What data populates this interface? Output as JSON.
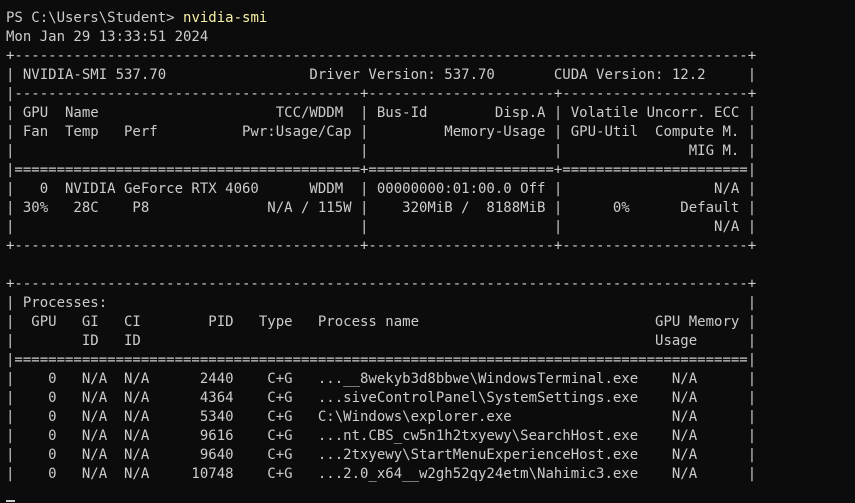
{
  "prompt": {
    "text": "PS C:\\Users\\Student> ",
    "command": "nvidia-smi"
  },
  "timestamp": "Mon Jan 29 13:33:51 2024",
  "output_lines": [
    "+---------------------------------------------------------------------------------------+",
    "| NVIDIA-SMI 537.70                 Driver Version: 537.70       CUDA Version: 12.2     |",
    "|-----------------------------------------+----------------------+----------------------+",
    "| GPU  Name                     TCC/WDDM  | Bus-Id        Disp.A | Volatile Uncorr. ECC |",
    "| Fan  Temp   Perf          Pwr:Usage/Cap |         Memory-Usage | GPU-Util  Compute M. |",
    "|                                         |                      |               MIG M. |",
    "|=========================================+======================+======================|",
    "|   0  NVIDIA GeForce RTX 4060      WDDM  | 00000000:01:00.0 Off |                  N/A |",
    "| 30%   28C    P8              N/A / 115W |    320MiB /  8188MiB |      0%      Default |",
    "|                                         |                      |                  N/A |",
    "+-----------------------------------------+----------------------+----------------------+",
    "",
    "+---------------------------------------------------------------------------------------+",
    "| Processes:                                                                            |",
    "|  GPU   GI   CI        PID   Type   Process name                            GPU Memory |",
    "|        ID   ID                                                             Usage      |",
    "|=======================================================================================|",
    "|    0   N/A  N/A      2440    C+G   ...__8wekyb3d8bbwe\\WindowsTerminal.exe    N/A      |",
    "|    0   N/A  N/A      4364    C+G   ...siveControlPanel\\SystemSettings.exe    N/A      |",
    "|    0   N/A  N/A      5340    C+G   C:\\Windows\\explorer.exe                   N/A      |",
    "|    0   N/A  N/A      9616    C+G   ...nt.CBS_cw5n1h2txyewy\\SearchHost.exe    N/A      |",
    "|    0   N/A  N/A      9640    C+G   ...2txyewy\\StartMenuExperienceHost.exe    N/A      |",
    "|    0   N/A  N/A     10748    C+G   ...2.0_x64__w2gh52qy24etm\\Nahimic3.exe    N/A      |"
  ]
}
